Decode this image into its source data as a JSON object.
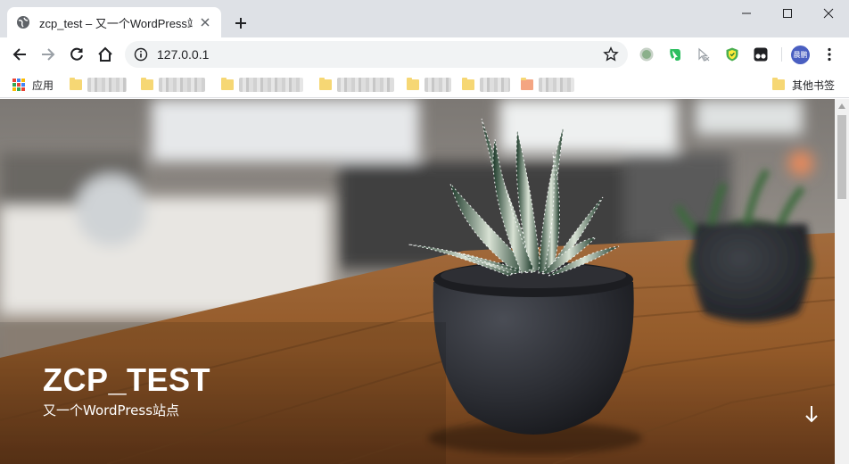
{
  "browser": {
    "tab": {
      "title": "zcp_test – 又一个WordPress站点"
    },
    "omnibox": {
      "url": "127.0.0.1"
    },
    "profile": {
      "initials": "晨鹏"
    },
    "bookmarks": {
      "apps_label": "应用",
      "other_label": "其他书签"
    },
    "icons": [
      "globe-icon",
      "close-icon",
      "plus-icon",
      "minimize-icon",
      "maximize-icon",
      "back-icon",
      "forward-icon",
      "reload-icon",
      "home-icon",
      "info-icon",
      "star-icon",
      "menu-dots-icon",
      "arrow-down-icon"
    ],
    "colors": {
      "tab_strip": "#dee1e6",
      "omnibox": "#f1f3f4",
      "profile": "#4a5fc1"
    }
  },
  "site": {
    "title": "ZCP_TEST",
    "description": "又一个WordPress站点"
  }
}
